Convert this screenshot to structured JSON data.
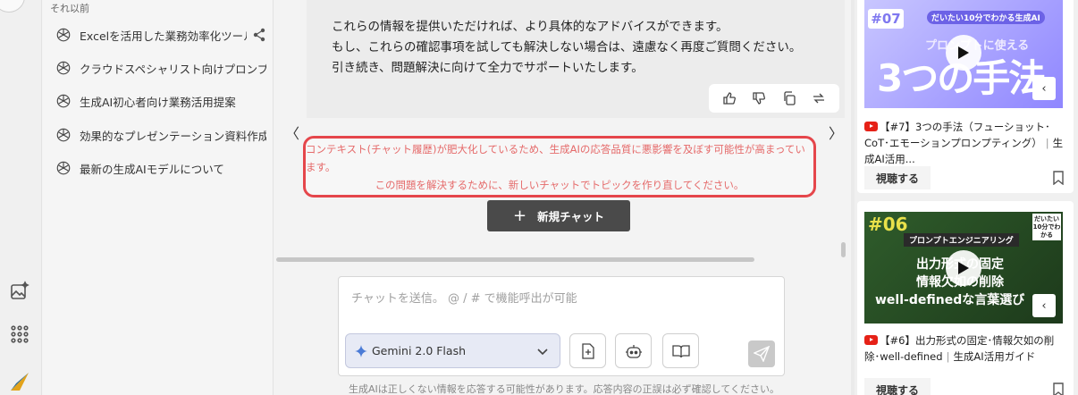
{
  "history": {
    "section_label": "それ以前",
    "items": [
      {
        "label": "Excelを活用した業務効率化ツール..."
      },
      {
        "label": "クラウドスペシャリスト向けプロンプト作成..."
      },
      {
        "label": "生成AI初心者向け業務活用提案"
      },
      {
        "label": "効果的なプレゼンテーション資料作成手順"
      },
      {
        "label": "最新の生成AIモデルについて"
      }
    ]
  },
  "message": {
    "lines": [
      "これらの情報を提供いただければ、より具体的なアドバイスができます。",
      "もし、これらの確認事項を試しても解決しない場合は、遠慮なく再度ご質問ください。",
      "引き続き、問題解決に向けて全力でサポートいたします。"
    ]
  },
  "nav": {
    "prev": "〈",
    "next": "〉"
  },
  "warning": {
    "line1": "コンテキスト(チャット履歴)が肥大化しているため、生成AIの応答品質に悪影響を及ぼす可能性が高まっています。",
    "line2": "この問題を解決するために、新しいチャットでトピックを作り直してください。",
    "color": "#e5464b"
  },
  "new_chat": {
    "icon": "+",
    "label": "新規チャット"
  },
  "input": {
    "placeholder": "チャットを送信。 @ / # で機能呼出が可能",
    "model": "Gemini 2.0 Flash"
  },
  "disclaimer": "生成AIは正しくない情報を応答する可能性があります。応答内容の正誤は必ず確認してください。",
  "videos": [
    {
      "badge": "#07",
      "thumb_top": "だいたい10分でわかる生成AI",
      "thumb_main": "3つの手法",
      "thumb_sub": "プロンプトに使える",
      "title": "【#7】3つの手法（フューショット･CoT･エモーションプロンプティング）",
      "channel": "生成AI活用...",
      "watch": "視聴する"
    },
    {
      "badge": "#06",
      "thumb_top": "だいたい10分でわかる",
      "thumb_tag": "プロンプトエンジニアリング",
      "thumb_lines": [
        "出力形式の固定",
        "情報欠如の削除",
        "well-definedな言葉選び"
      ],
      "title": "【#6】出力形式の固定･情報欠如の削除･well-defined",
      "channel": "生成AI活用ガイド",
      "watch": "視聴する"
    }
  ],
  "icons": {
    "gpt": "openai-logo-icon",
    "share": "share-icon",
    "thumbs_up": "thumbs-up-icon",
    "thumbs_down": "thumbs-down-icon",
    "copy": "copy-icon",
    "regenerate": "regenerate-icon",
    "send": "send-icon"
  }
}
